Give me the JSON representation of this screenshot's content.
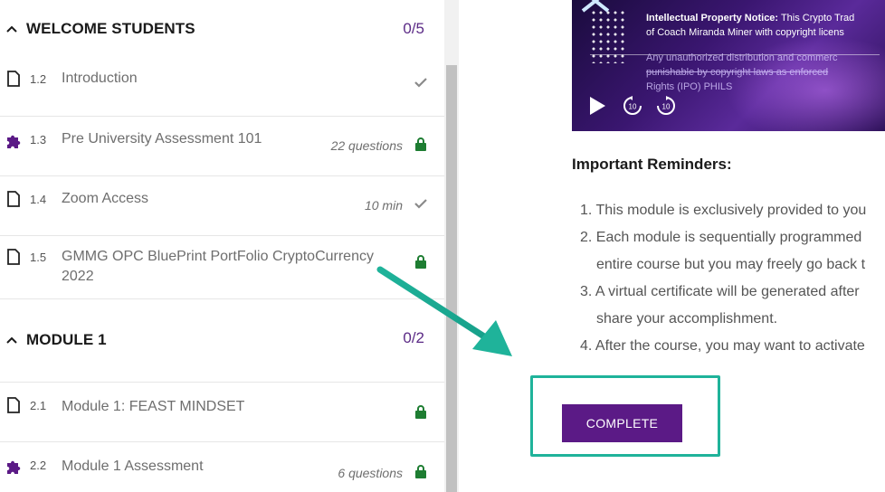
{
  "sidebar": {
    "sections": [
      {
        "title": "WELCOME STUDENTS",
        "progress": "0/5",
        "lessons": [
          {
            "num": "1.2",
            "name": "Introduction",
            "meta": "",
            "status": "check-icon",
            "type": "page-icon"
          },
          {
            "num": "1.3",
            "name": "Pre University Assessment 101",
            "meta": "22 questions",
            "status": "lock-icon",
            "type": "quiz-icon"
          },
          {
            "num": "1.4",
            "name": "Zoom Access",
            "meta": "10 min",
            "status": "check-icon",
            "type": "page-icon"
          },
          {
            "num": "1.5",
            "name": "GMMG OPC BluePrint PortFolio CryptoCurrency 2022",
            "meta": "",
            "status": "lock-icon",
            "type": "page-icon"
          }
        ]
      },
      {
        "title": "MODULE 1",
        "progress": "0/2",
        "lessons": [
          {
            "num": "2.1",
            "name": "Module 1: FEAST MINDSET",
            "meta": "",
            "status": "lock-icon",
            "type": "page-icon"
          },
          {
            "num": "2.2",
            "name": "Module 1 Assessment",
            "meta": "6 questions",
            "status": "lock-icon",
            "type": "quiz-icon"
          }
        ]
      }
    ]
  },
  "video": {
    "notice_bold": "Intellectual Property Notice:",
    "notice_rest": " This Crypto Trad",
    "line2": "of Coach Miranda Miner with copyright licens",
    "line3": "Any unauthorized distribution and commerc",
    "line4": "punishable by copyright laws as enforced",
    "line5": "Rights (IPO) PHILS",
    "rewind_label": "10",
    "forward_label": "10"
  },
  "main": {
    "reminders_heading": "Important Reminders:",
    "reminders": [
      "1. This module is exclusively provided to you",
      "2. Each module is sequentially programmed",
      "entire course but you may freely go back t",
      "3. A virtual certificate will be generated after",
      "share your accomplishment.",
      "4. After the course, you may want to activate"
    ],
    "complete_label": "COMPLETE"
  },
  "colors": {
    "accent_purple": "#5b1a86",
    "highlight_teal": "#1fb39a",
    "lock_green": "#1e7d32"
  }
}
